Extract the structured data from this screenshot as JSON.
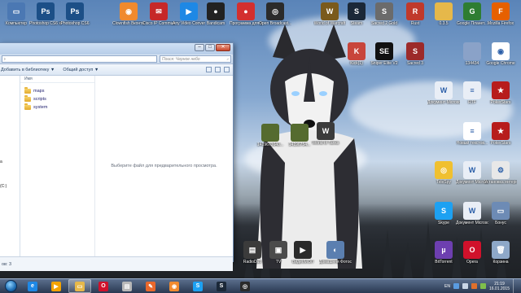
{
  "desktop_top_row": [
    {
      "id": "computer",
      "label": "Компьютер",
      "color": "#4b78b3",
      "glyph": "▭"
    },
    {
      "id": "ps-cs6-x64",
      "label": "Photoshop CS6 x64",
      "color": "#1c4f87",
      "glyph": "Ps"
    },
    {
      "id": "ps-cs6",
      "label": "Photoshop CS6",
      "color": "#1c4f87",
      "glyph": "Ps"
    },
    {
      "id": "chrome-clownfish",
      "label": "Clownfish Вконта...",
      "color": "#f08a2e",
      "glyph": "◉"
    },
    {
      "id": "cisco-ip-comm",
      "label": "Cisco IP Communic...",
      "color": "#c62828",
      "glyph": "✉"
    },
    {
      "id": "any-video",
      "label": "Any Video Converter...",
      "color": "#1e88e5",
      "glyph": "▶"
    },
    {
      "id": "bandicam",
      "label": "Bandicam",
      "color": "#222222",
      "glyph": "●"
    },
    {
      "id": "program-record",
      "label": "Программа для записи...",
      "color": "#d32f2f",
      "glyph": "●"
    },
    {
      "id": "obs",
      "label": "Open Broadcast...",
      "color": "#2b2b2b",
      "glyph": "◎"
    },
    {
      "id": "wow",
      "label": "World of Warcraft",
      "color": "#7a5a1c",
      "glyph": "W"
    },
    {
      "id": "steam",
      "label": "Steam",
      "color": "#1b2838",
      "glyph": "S"
    },
    {
      "id": "sacred2",
      "label": "Sacred 2 Gold",
      "color": "#6b6b6b",
      "glyph": "S"
    },
    {
      "id": "rust",
      "label": "Rust",
      "color": "#c0392b",
      "glyph": "R"
    },
    {
      "id": "folder-035",
      "label": "0.3.5",
      "color": "#e6b84a",
      "glyph": ""
    },
    {
      "id": "google-maps",
      "label": "Google Планет...",
      "color": "#2e7d32",
      "glyph": "G"
    },
    {
      "id": "firefox",
      "label": "Mozilla Firefox",
      "color": "#e66000",
      "glyph": "F"
    }
  ],
  "desktop_second_row": [
    {
      "id": "kick",
      "label": "Kick(1)",
      "color": "#c8453b",
      "glyph": "K"
    },
    {
      "id": "sniper-elite",
      "label": "Sniper Elite V2",
      "color": "#111111",
      "glyph": "SE"
    },
    {
      "id": "sacred3",
      "label": "Sacred 3",
      "color": "#9c2a2a",
      "glyph": "S"
    },
    {
      "id": "file-134434",
      "label": "134434",
      "color": "#8aa2c8",
      "glyph": ""
    },
    {
      "id": "google-chrome",
      "label": "Google Chrome",
      "color": "#ffffff",
      "glyph": "◉"
    }
  ],
  "desktop_right_column": [
    {
      "id": "doc-ms",
      "label": "Документ Microsoft...",
      "color": "#e9eef6",
      "glyph": "W"
    },
    {
      "id": "rtf",
      "label": "RTF",
      "color": "#e9eef6",
      "glyph": "≡"
    },
    {
      "id": "pokerstars1",
      "label": "PokerStars",
      "color": "#b71c1c",
      "glyph": "★"
    },
    {
      "id": "new-text",
      "label": "Новый текстов...",
      "color": "#ffffff",
      "glyph": "≡"
    },
    {
      "id": "pokerstars2",
      "label": "PokerStars",
      "color": "#b71c1c",
      "glyph": "★"
    },
    {
      "id": "wot-desktop",
      "label": "World of Tanks",
      "color": "#3b3b3b",
      "glyph": "W"
    },
    {
      "id": "tools-spy",
      "label": "TeleSpy",
      "color": "#f0c030",
      "glyph": "◎"
    },
    {
      "id": "doc-ms2",
      "label": "Документ Microsoft...",
      "color": "#e9eef6",
      "glyph": "W"
    },
    {
      "id": "ustanovka",
      "label": "Установка интернет...",
      "color": "#e8e8e8",
      "glyph": "⚙"
    },
    {
      "id": "skype",
      "label": "Skype",
      "color": "#1da1f2",
      "glyph": "S"
    },
    {
      "id": "doc-ms3",
      "label": "Документ Microsoft...",
      "color": "#e9eef6",
      "glyph": "W"
    },
    {
      "id": "mes-bonus",
      "label": "Бонус",
      "color": "#6d8bb5",
      "glyph": "▭"
    },
    {
      "id": "bittorrent",
      "label": "BitTorrent",
      "color": "#6d3fb0",
      "glyph": "µ"
    },
    {
      "id": "opera",
      "label": "Opera",
      "color": "#d0112b",
      "glyph": "O"
    },
    {
      "id": "trash",
      "label": "Корзина",
      "color": "#8ea8c8",
      "glyph": "🗑"
    }
  ],
  "desktop_middle": [
    {
      "id": "screenshot1",
      "label": "1419673640...",
      "color": "#556b2f",
      "glyph": ""
    },
    {
      "id": "screenshot2",
      "label": "14196754...",
      "color": "#556b2f",
      "glyph": ""
    },
    {
      "id": "wot-mid",
      "label": "World of Tanks",
      "color": "#2e2e2e",
      "glyph": "W"
    }
  ],
  "desktop_bottom_row": [
    {
      "id": "radiodub",
      "label": "RadioDub",
      "color": "#3b3b3b",
      "glyph": "▤"
    },
    {
      "id": "tv",
      "label": "TV",
      "color": "#4b4b4b",
      "glyph": "▣"
    },
    {
      "id": "video-mol",
      "label": "ВидеоМОЛ",
      "color": "#2a2a2a",
      "glyph": "▶"
    },
    {
      "id": "home-photo",
      "label": "Домашняя Фотостудия",
      "color": "#5b7fb0",
      "glyph": "◐"
    }
  ],
  "explorer": {
    "address_tail": "›",
    "search_placeholder": "Поиск: Черное небо",
    "toolbar_add_library": "Добавить в библиотеку ▼",
    "toolbar_share": "Общий доступ ▼",
    "column_name": "Имя",
    "files": [
      {
        "name": "maps"
      },
      {
        "name": "scripts"
      },
      {
        "name": "system"
      }
    ],
    "preview_text": "Выберите файл для предварительного просмотра.",
    "status_text": "ов: 3",
    "nav_labels": [
      "а",
      "(C:)"
    ]
  },
  "taskbar": {
    "pins": [
      {
        "id": "ie",
        "color": "#1e88e5",
        "glyph": "e"
      },
      {
        "id": "wmp",
        "color": "#f4a300",
        "glyph": "▶"
      },
      {
        "id": "explorer",
        "color": "#e6b84a",
        "glyph": "▭",
        "active": true
      },
      {
        "id": "opera",
        "color": "#d0112b",
        "glyph": "O"
      },
      {
        "id": "unknown",
        "color": "#b8b8b8",
        "glyph": "▤"
      },
      {
        "id": "paint",
        "color": "#e9682c",
        "glyph": "✎"
      },
      {
        "id": "clownfish",
        "color": "#f08a2e",
        "glyph": "◉"
      },
      {
        "id": "skype",
        "color": "#1da1f2",
        "glyph": "S"
      },
      {
        "id": "steam",
        "color": "#1b2838",
        "glyph": "S"
      },
      {
        "id": "obs",
        "color": "#2b2b2b",
        "glyph": "◎"
      }
    ],
    "language": "EN",
    "time": "21:19",
    "date": "16.01.2015"
  }
}
